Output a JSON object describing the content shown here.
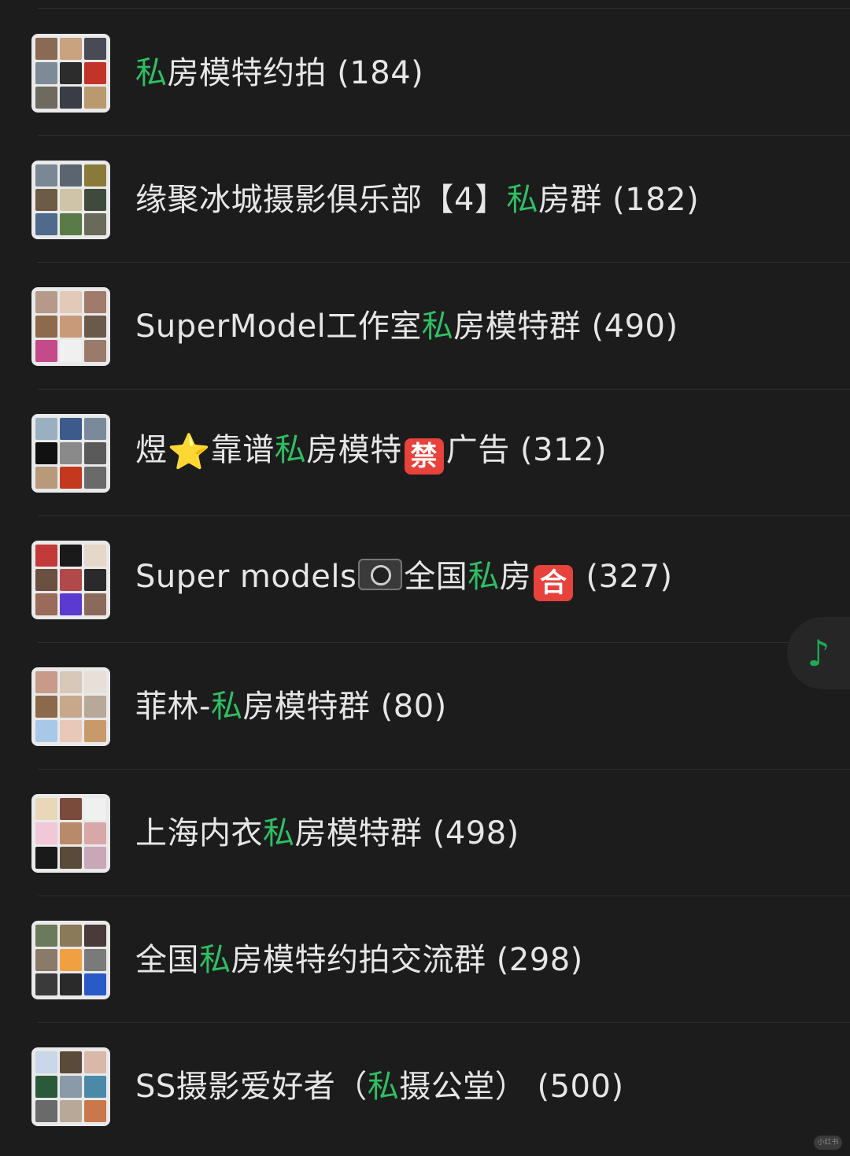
{
  "groups": [
    {
      "name_pre": "",
      "name_hl": "私",
      "name_post": "房模特约拍",
      "count": "(184)"
    },
    {
      "name_pre": "缘聚冰城摄影俱乐部【4】",
      "name_hl": "私",
      "name_post": "房群",
      "count": "(182)"
    },
    {
      "name_pre": "SuperModel工作室",
      "name_hl": "私",
      "name_post": "房模特群",
      "count": "(490)"
    },
    {
      "name_pre": "煜",
      "star": "⭐",
      "name_pre2": "靠谱",
      "name_hl": "私",
      "name_post": "房模特",
      "badge": "禁",
      "name_post2": "广告",
      "count": "(312)"
    },
    {
      "name_pre": "Super models",
      "camera": "camera-emoji",
      "name_pre2": "全国",
      "name_hl": "私",
      "name_post": "房",
      "badge": "合",
      "count": "(327)"
    },
    {
      "name_pre": "菲林-",
      "name_hl": "私",
      "name_post": "房模特群",
      "count": "(80)"
    },
    {
      "name_pre": "上海内衣",
      "name_hl": "私",
      "name_post": "房模特群",
      "count": "(498)"
    },
    {
      "name_pre": "全国",
      "name_hl": "私",
      "name_post": "房模特约拍交流群",
      "count": "(298)"
    },
    {
      "name_pre": "SS摄影爱好者（",
      "name_hl": "私",
      "name_post": "摄公堂）",
      "count": "(500)"
    }
  ],
  "fab": {
    "icon": "music-note-icon",
    "glyph": "♪"
  },
  "watermark": "小红书",
  "colors": {
    "highlight": "#2fbf63",
    "background": "#1c1c1c",
    "text": "#e6e6e6"
  }
}
